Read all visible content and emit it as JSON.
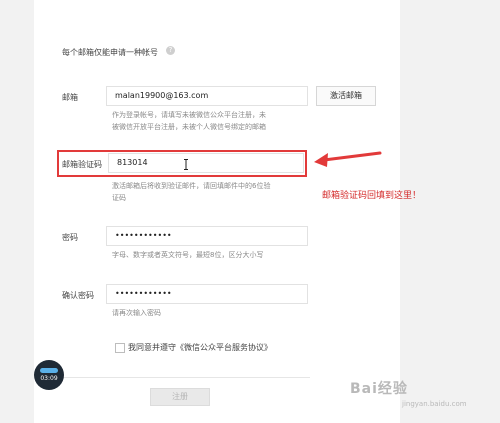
{
  "form": {
    "intro": "每个邮箱仅能申请一种帐号",
    "help_icon": "?",
    "email": {
      "label": "邮箱",
      "value": "malan19900@163.com",
      "activate_button": "激活邮箱",
      "hint_line1": "作为登录帐号，请填写未被微信公众平台注册，未",
      "hint_line2": "被微信开放平台注册，未被个人微信号绑定的邮箱"
    },
    "verify_code": {
      "label": "邮箱验证码",
      "value": "813014",
      "hint_line1": "激活邮箱后将收到验证邮件，请回填邮件中的6位验",
      "hint_line2": "证码"
    },
    "password": {
      "label": "密码",
      "value": "••••••••••••",
      "hint": "字母、数字或者英文符号，最短8位，区分大小写"
    },
    "confirm_password": {
      "label": "确认密码",
      "value": "••••••••••••",
      "hint": "请再次输入密码"
    },
    "agreement": "我同意并遵守《微信公众平台服务协议》",
    "register_button": "注册"
  },
  "annotation": {
    "text": "邮箱验证码回填到这里！",
    "color": "#d42a2a"
  },
  "player": {
    "time": "03:09"
  },
  "watermark": {
    "text": "Bai经验",
    "url": "jingyan.baidu.com"
  },
  "icons": [
    "help-icon",
    "text-cursor-icon",
    "red-arrow-icon",
    "checkbox-icon",
    "audio-wave-icon"
  ]
}
